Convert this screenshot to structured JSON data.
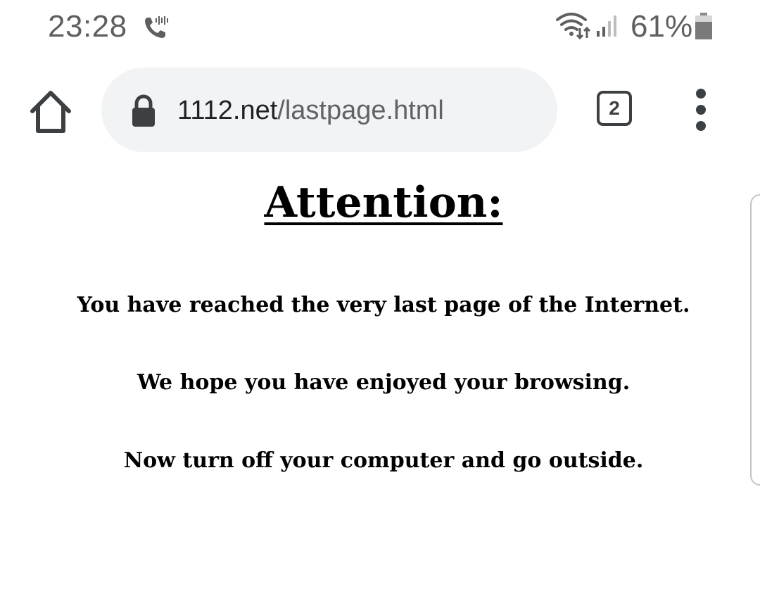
{
  "status_bar": {
    "time": "23:28",
    "battery_percent": "61%",
    "icons": [
      "call-icon",
      "wifi-icon",
      "signal-icon",
      "battery-icon"
    ]
  },
  "toolbar": {
    "url_domain": "1112.net",
    "url_path": "/lastpage.html",
    "tab_count": "2",
    "icons": [
      "home-icon",
      "lock-icon",
      "tab-switcher-icon",
      "more-vert-icon"
    ]
  },
  "page": {
    "heading": "Attention:",
    "lines": [
      "You have reached the very last page of the Internet.",
      "We hope you have enjoyed your browsing.",
      "Now turn off your computer and go outside."
    ]
  },
  "colors": {
    "status_text": "#5f5f5f",
    "url_bar_bg": "#f1f3f4",
    "icon_dark": "#3c4043",
    "page_text": "#000000"
  }
}
